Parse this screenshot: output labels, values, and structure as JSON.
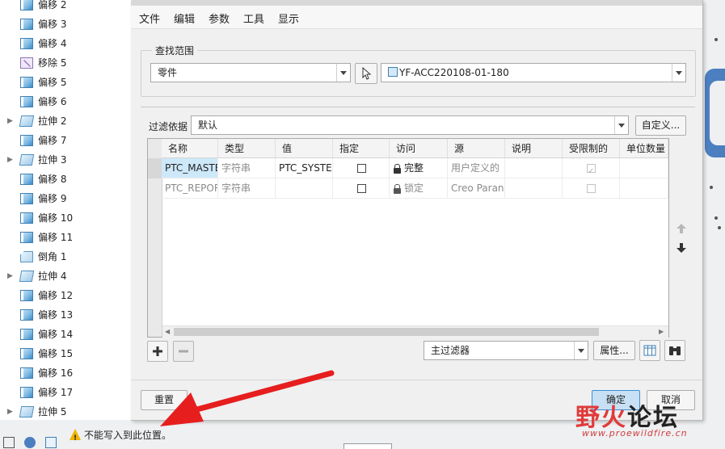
{
  "tree": {
    "items": [
      {
        "label": "偏移 2",
        "icon": "offset-icon",
        "expandable": false
      },
      {
        "label": "偏移 3",
        "icon": "offset-icon",
        "expandable": false
      },
      {
        "label": "偏移 4",
        "icon": "offset-icon",
        "expandable": false
      },
      {
        "label": "移除 5",
        "icon": "move-icon",
        "expandable": false
      },
      {
        "label": "偏移 5",
        "icon": "offset-icon",
        "expandable": false
      },
      {
        "label": "偏移 6",
        "icon": "offset-icon",
        "expandable": false
      },
      {
        "label": "拉伸 2",
        "icon": "extrude-icon",
        "expandable": true
      },
      {
        "label": "偏移 7",
        "icon": "offset-icon",
        "expandable": false
      },
      {
        "label": "拉伸 3",
        "icon": "extrude-icon",
        "expandable": true
      },
      {
        "label": "偏移 8",
        "icon": "offset-icon",
        "expandable": false
      },
      {
        "label": "偏移 9",
        "icon": "offset-icon",
        "expandable": false
      },
      {
        "label": "偏移 10",
        "icon": "offset-icon",
        "expandable": false
      },
      {
        "label": "偏移 11",
        "icon": "offset-icon",
        "expandable": false
      },
      {
        "label": "倒角 1",
        "icon": "chamfer-icon",
        "expandable": false
      },
      {
        "label": "拉伸 4",
        "icon": "extrude-icon",
        "expandable": true
      },
      {
        "label": "偏移 12",
        "icon": "offset-icon",
        "expandable": false
      },
      {
        "label": "偏移 13",
        "icon": "offset-icon",
        "expandable": false
      },
      {
        "label": "偏移 14",
        "icon": "offset-icon",
        "expandable": false
      },
      {
        "label": "偏移 15",
        "icon": "offset-icon",
        "expandable": false
      },
      {
        "label": "偏移 16",
        "icon": "offset-icon",
        "expandable": false
      },
      {
        "label": "偏移 17",
        "icon": "offset-icon",
        "expandable": false
      },
      {
        "label": "拉伸 5",
        "icon": "extrude-icon",
        "expandable": true
      }
    ]
  },
  "dialog": {
    "menu": [
      "文件",
      "编辑",
      "参数",
      "工具",
      "显示"
    ],
    "lookin_title": "查找范围",
    "lookin_type": "零件",
    "lookin_object": "YF-ACC220108-01-180",
    "filter_label": "过滤依据",
    "filter_value": "默认",
    "customize_button": "自定义...",
    "columns": [
      "名称",
      "类型",
      "值",
      "指定",
      "访问",
      "源",
      "说明",
      "受限制的",
      "单位数量"
    ],
    "rows": [
      {
        "name": "PTC_MASTE",
        "type": "字符串",
        "value": "PTC_SYSTEM",
        "designate": false,
        "access": "完整",
        "source": "用户定义的",
        "description": "",
        "restricted": true,
        "units": ""
      },
      {
        "name": "PTC_REPOR",
        "type": "字符串",
        "value": "",
        "designate": false,
        "access": "锁定",
        "source": "Creo Paran",
        "description": "",
        "restricted": false,
        "units": ""
      }
    ],
    "main_filter": "主过滤器",
    "properties_button": "属性...",
    "reset_button": "重置",
    "ok_button": "确定",
    "cancel_button": "取消"
  },
  "status": {
    "warning": "不能写入到此位置。"
  },
  "watermark": {
    "chars": [
      "野",
      "火",
      "论",
      "坛"
    ],
    "url": "www.proewildfire.cn"
  },
  "colors": {
    "accent": "#cde8f9",
    "arrow": "#e61e1e",
    "watermark_red": "#e03a3a",
    "watermark_dark": "#222222",
    "ok_blue": "#c7e0f4"
  }
}
